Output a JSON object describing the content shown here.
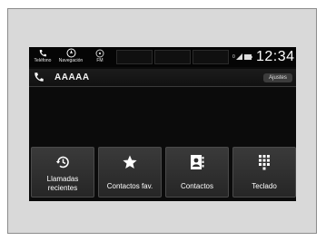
{
  "statusbar": {
    "phone_label": "Teléfono",
    "nav_label": "Navegación",
    "radio_label": "FM",
    "signal_number": "0",
    "clock": "12:34"
  },
  "call": {
    "name": "AAAAA",
    "settings_label": "Ajustes"
  },
  "tiles": [
    {
      "icon": "recent-calls-icon",
      "line1": "Llamadas",
      "line2": "recientes"
    },
    {
      "icon": "star-icon",
      "label": "Contactos fav."
    },
    {
      "icon": "contacts-book-icon",
      "label": "Contactos"
    },
    {
      "icon": "keypad-icon",
      "label": "Teclado"
    }
  ],
  "colors": {
    "screen_bg": "#0b0b0b",
    "tile_bg": "#303030",
    "frame_bg": "#d9d9d9"
  }
}
